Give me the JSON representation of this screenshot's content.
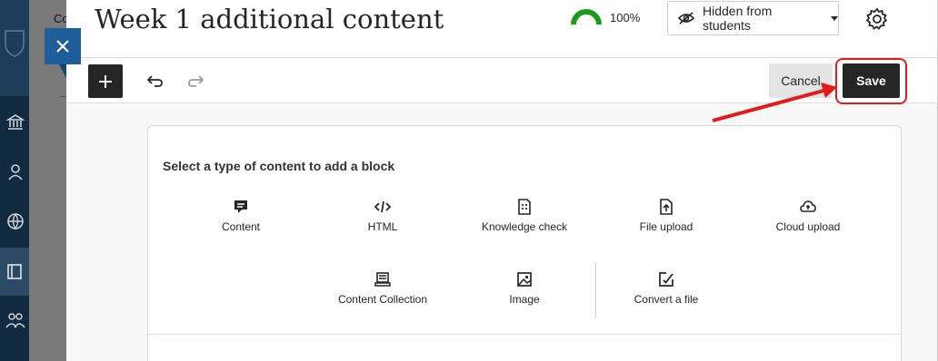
{
  "app": {
    "breadcrumb_partial": "Co",
    "sidebar_icons": [
      "institution-icon",
      "user-icon",
      "globe-icon",
      "courses-icon",
      "groups-icon"
    ]
  },
  "panel": {
    "title": "Week 1 additional content",
    "progress": {
      "label": "100%",
      "value": 1.0,
      "color": "#1a9b1a"
    },
    "visibility": {
      "label": "Hidden from students"
    },
    "toolbar": {
      "cancel_label": "Cancel",
      "save_label": "Save"
    }
  },
  "block_picker": {
    "prompt": "Select a type of content to add a block",
    "options": [
      {
        "label": "Content",
        "icon": "content-icon"
      },
      {
        "label": "HTML",
        "icon": "code-icon"
      },
      {
        "label": "Knowledge check",
        "icon": "knowledge-check-icon"
      },
      {
        "label": "File upload",
        "icon": "file-upload-icon"
      },
      {
        "label": "Cloud upload",
        "icon": "cloud-upload-icon"
      },
      {
        "label": "Content Collection",
        "icon": "content-collection-icon"
      },
      {
        "label": "Image",
        "icon": "image-icon"
      },
      {
        "label": "Convert a file",
        "icon": "convert-file-icon"
      }
    ]
  },
  "annotation": {
    "color": "#e31b1b"
  }
}
